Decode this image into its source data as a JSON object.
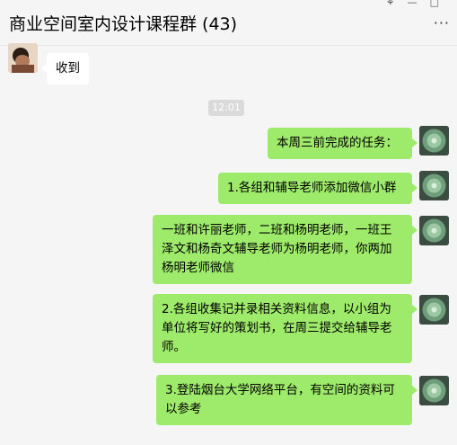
{
  "header": {
    "title": "商业空间室内设计课程群 (43)",
    "more_icon": "more-icon",
    "pin_icon": "pin-icon",
    "min_icon": "minimize-icon",
    "max_icon": "maximize-icon"
  },
  "timestamp": "12:01",
  "messages": [
    {
      "from": "other",
      "text": "收到"
    },
    {
      "from": "me",
      "text": "本周三前完成的任务："
    },
    {
      "from": "me",
      "text": "1.各组和辅导老师添加微信小群"
    },
    {
      "from": "me",
      "text": "一班和许丽老师，二班和杨明老师，一班王泽文和杨奇文辅导老师为杨明老师，你两加杨明老师微信"
    },
    {
      "from": "me",
      "text": "2.各组收集记并录相关资料信息，以小组为单位将写好的策划书，在周三提交给辅导老师。"
    },
    {
      "from": "me",
      "text": "3.登陆烟台大学网络平台，有空间的资料可以参考"
    }
  ],
  "colors": {
    "my_bubble": "#9eea6a",
    "other_bubble": "#ffffff",
    "background": "#f5f5f5"
  }
}
